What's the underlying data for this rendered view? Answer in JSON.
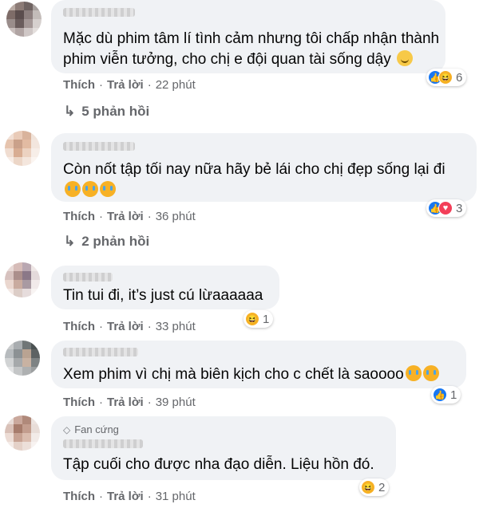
{
  "comments": [
    {
      "text_lines": [
        "Mặc dù phim tâm lí tình cảm nhưng tôi chấp nhận thành",
        "phim viễn tưởng, cho chị e đội quan tài sống dậy"
      ],
      "like_label": "Thích",
      "reply_label": "Trả lời",
      "time": "22 phút",
      "reaction_icons": [
        "like-icon",
        "haha-icon"
      ],
      "reaction_count": "6",
      "replies_label": "5 phản hồi"
    },
    {
      "text_lines": [
        "Còn nốt tập tối nay nữa hãy bẻ lái cho chị đẹp sống lại đi"
      ],
      "like_label": "Thích",
      "reply_label": "Trả lời",
      "time": "36 phút",
      "reaction_icons": [
        "like-icon",
        "heart-icon"
      ],
      "reaction_count": "3",
      "replies_label": "2 phản hồi"
    },
    {
      "text_lines": [
        "Tin tui đi, it’s just cú lừaaaaaa"
      ],
      "like_label": "Thích",
      "reply_label": "Trả lời",
      "time": "33 phút",
      "reaction_icons": [
        "haha-icon"
      ],
      "reaction_count": "1"
    },
    {
      "text_lines": [
        "Xem phim vì chị mà biên kịch cho c chết là saoooo"
      ],
      "like_label": "Thích",
      "reply_label": "Trả lời",
      "time": "39 phút",
      "reaction_icons": [
        "like-icon"
      ],
      "reaction_count": "1"
    },
    {
      "badge": "Fan cứng",
      "text_lines": [
        "Tập cuối cho được nha đạo diễn. Liệu hồn đó."
      ],
      "like_label": "Thích",
      "reply_label": "Trả lời",
      "time": "31 phút",
      "reaction_icons": [
        "haha-icon"
      ],
      "reaction_count": "2"
    }
  ],
  "colors": {
    "bubble": "#f0f2f5",
    "meta": "#65676b",
    "like": "#1877f2",
    "heart": "#f33e58",
    "haha": "#f7b125"
  }
}
